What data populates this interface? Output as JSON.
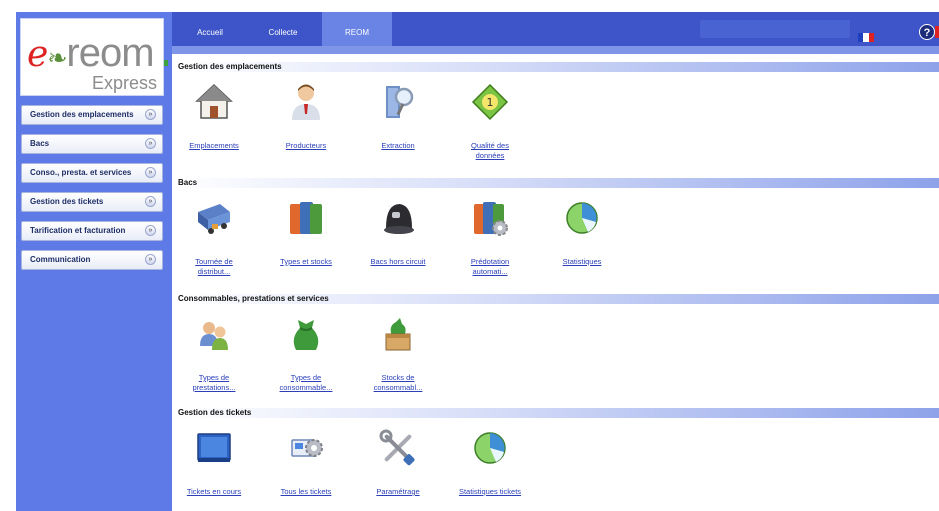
{
  "logo": {
    "brand": "e-reom",
    "main_text": "reom",
    "sub_text": "Express"
  },
  "nav": {
    "tabs": [
      {
        "label": "Accueil"
      },
      {
        "label": "Collecte"
      },
      {
        "label": "REOM"
      }
    ],
    "active_tab": "REOM"
  },
  "sidebar": {
    "items": [
      {
        "label": "Gestion des emplacements"
      },
      {
        "label": "Bacs"
      },
      {
        "label": "Conso., presta. et services"
      },
      {
        "label": "Gestion des tickets"
      },
      {
        "label": "Tarification et facturation"
      },
      {
        "label": "Communication"
      }
    ]
  },
  "header": {
    "help_symbol": "?",
    "language_flag": "french-flag-icon"
  },
  "sections": [
    {
      "title": "Gestion des emplacements",
      "items": [
        {
          "label": "Emplacements",
          "icon": "house-icon"
        },
        {
          "label": "Producteurs",
          "icon": "person-icon"
        },
        {
          "label": "Extraction",
          "icon": "magnifier-icon"
        },
        {
          "label": "Qualité des données",
          "icon": "quality-diamond-icon"
        }
      ]
    },
    {
      "title": "Bacs",
      "items": [
        {
          "label": "Tournée de distribut...",
          "icon": "delivery-truck-icon"
        },
        {
          "label": "Types et stocks",
          "icon": "bins-icon"
        },
        {
          "label": "Bacs hors circuit",
          "icon": "helmet-bin-icon"
        },
        {
          "label": "Prédotation automati...",
          "icon": "bins-gear-icon"
        },
        {
          "label": "Statistiques",
          "icon": "pie-chart-icon"
        }
      ]
    },
    {
      "title": "Consommables, prestations et services",
      "items": [
        {
          "label": "Types de prestations...",
          "icon": "people-icon"
        },
        {
          "label": "Types de consommable...",
          "icon": "garbage-bag-icon"
        },
        {
          "label": "Stocks de consommabl...",
          "icon": "box-bag-icon"
        }
      ]
    },
    {
      "title": "Gestion des tickets",
      "items": [
        {
          "label": "Tickets en cours",
          "icon": "monitor-icon"
        },
        {
          "label": "Tous les tickets",
          "icon": "tickets-gear-icon"
        },
        {
          "label": "Paramétrage",
          "icon": "tools-icon"
        },
        {
          "label": "Statistiques tickets",
          "icon": "pie-chart-icon"
        }
      ]
    }
  ],
  "colors": {
    "topbar": "#3d55c9",
    "sidebar": "#5d7ae6",
    "link": "#2a3fb8"
  }
}
